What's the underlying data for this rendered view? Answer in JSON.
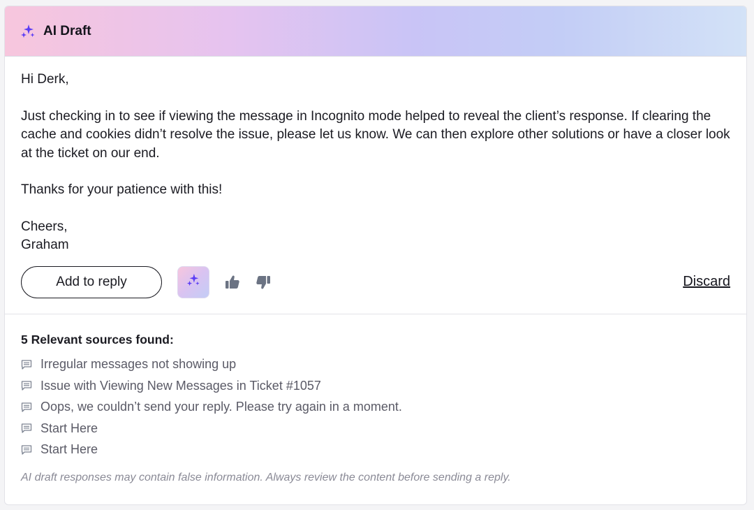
{
  "header": {
    "title": "AI Draft",
    "icon": "sparkle-icon",
    "accent_color": "#5b3df5"
  },
  "draft": {
    "greeting": "Hi Derk,",
    "paragraph": "Just checking in to see if viewing the message in Incognito mode helped to reveal the client’s response. If clearing the cache and cookies didn’t resolve the issue, please let us know. We can then explore other solutions or have a closer look at the ticket on our end.",
    "thanks": "Thanks for your patience with this!",
    "signoff": "Cheers,",
    "signature": "Graham"
  },
  "actions": {
    "add_to_reply": "Add to reply",
    "discard": "Discard",
    "regenerate_icon": "sparkle-icon",
    "thumbs_up_icon": "thumbs-up-icon",
    "thumbs_down_icon": "thumbs-down-icon"
  },
  "sources": {
    "heading": "5 Relevant sources found:",
    "items": [
      {
        "label": "Irregular messages not showing up",
        "icon": "message-icon"
      },
      {
        "label": "Issue with Viewing New Messages in Ticket #1057",
        "icon": "message-icon"
      },
      {
        "label": "Oops, we couldn’t send your reply. Please try again in a moment.",
        "icon": "message-icon"
      },
      {
        "label": "Start Here",
        "icon": "message-icon"
      },
      {
        "label": "Start Here",
        "icon": "message-icon"
      }
    ]
  },
  "disclaimer": "AI draft responses may contain false information. Always review the content before sending a reply."
}
